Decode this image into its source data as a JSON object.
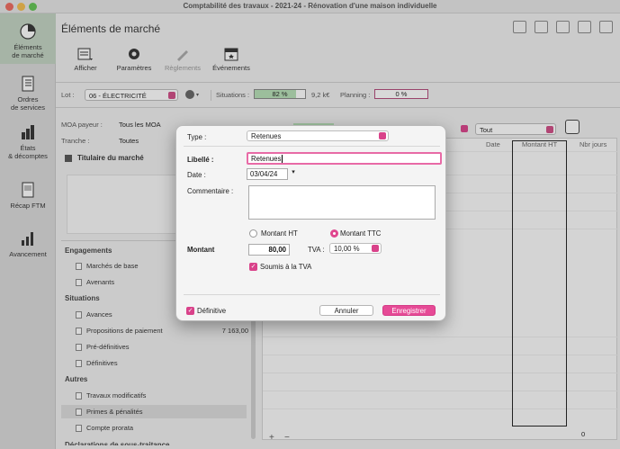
{
  "window": {
    "title": "Comptabilité des travaux - 2021-24 - Rénovation d'une maison individuelle"
  },
  "sidebar": {
    "items": [
      {
        "label": "Éléments\nde marché",
        "icon": "pie-chart-icon",
        "active": true
      },
      {
        "label": "Ordres\nde services",
        "icon": "document-list-icon",
        "active": false
      },
      {
        "label": "États\n& décomptes",
        "icon": "bar-chart-icon",
        "active": false
      },
      {
        "label": "Récap FTM",
        "icon": "document-icon",
        "active": false
      },
      {
        "label": "Avancement",
        "icon": "progress-bars-icon",
        "active": false
      }
    ]
  },
  "page": {
    "title": "Éléments de marché"
  },
  "toolbar": {
    "afficher": "Afficher",
    "parametres": "Paramètres",
    "reglements": "Règlements",
    "evenements": "Événements"
  },
  "lotbar": {
    "lot_label": "Lot :",
    "lot_value": "06 - ÉLECTRICITÉ",
    "situations_label": "Situations :",
    "situations_percent": "82 %",
    "situations_fill": 0.82,
    "situations_amount": "9,2 k€",
    "planning_label": "Planning :",
    "planning_percent": "0 %",
    "planning_fill": 0
  },
  "filters": {
    "moa_label": "MOA payeur :",
    "moa_value": "Tous les MOA",
    "tranche_label": "Tranche :",
    "tranche_value": "Toutes",
    "tout_value": "Tout",
    "titulaire": "Titulaire du marché"
  },
  "list": {
    "engagements": "Engagements",
    "marches": "Marchés de base",
    "avenants": "Avenants",
    "situations": "Situations",
    "avances": "Avances",
    "propositions": "Propositions de paiement",
    "propositions_value": "7 163,00",
    "predefinitives": "Pré-définitives",
    "definitives": "Définitives",
    "autres": "Autres",
    "travaux": "Travaux modificatifs",
    "primes": "Primes & pénalités",
    "compte": "Compte prorata",
    "declarations": "Déclarations de sous-traitance"
  },
  "table": {
    "date": "Date",
    "montant_ht": "Montant HT",
    "nbr_jours": "Nbr jours",
    "total": "0",
    "add": "+",
    "remove": "−"
  },
  "dialog": {
    "type_label": "Type :",
    "type_value": "Retenues",
    "libelle_label": "Libellé :",
    "libelle_value": "Retenues",
    "date_label": "Date :",
    "date_value": "03/04/24",
    "commentaire_label": "Commentaire :",
    "commentaire_value": "",
    "montant_ht": "Montant HT",
    "montant_ttc": "Montant TTC",
    "montant_label": "Montant",
    "montant_value": "80,00",
    "tva_label": "TVA :",
    "tva_value": "10,00 %",
    "soumis": "Soumis à la TVA",
    "definitive": "Définitive",
    "annuler": "Annuler",
    "enregistrer": "Enregistrer"
  }
}
